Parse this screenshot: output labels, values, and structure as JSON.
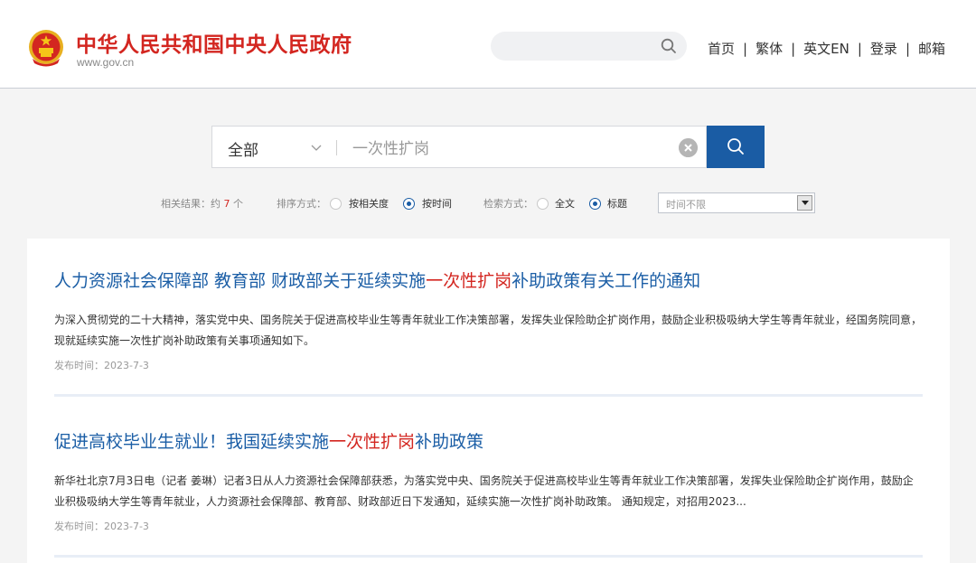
{
  "header": {
    "site_title": "中华人民共和国中央人民政府",
    "site_url": "www.gov.cn",
    "nav": [
      {
        "label": "首页"
      },
      {
        "label": "繁体"
      },
      {
        "label": "英文EN"
      },
      {
        "label": "登录"
      },
      {
        "label": "邮箱"
      }
    ],
    "separator": "|",
    "search_placeholder": ""
  },
  "search": {
    "scope": "全部",
    "query": "一次性扩岗"
  },
  "filters": {
    "result_count_prefix": "相关结果：约",
    "result_count": "7",
    "result_count_suffix": "个",
    "sort_label": "排序方式：",
    "sort_options": [
      "按相关度",
      "按时间"
    ],
    "sort_selected": "按时间",
    "mode_label": "检索方式：",
    "mode_options": [
      "全文",
      "标题"
    ],
    "mode_selected": "标题",
    "time_select": "时间不限"
  },
  "results": [
    {
      "title_before": "人力资源社会保障部 教育部 财政部关于延续实施",
      "title_highlight": "一次性扩岗",
      "title_after": "补助政策有关工作的通知",
      "abstract": "为深入贯彻党的二十大精神，落实党中央、国务院关于促进高校毕业生等青年就业工作决策部署，发挥失业保险助企扩岗作用，鼓励企业积极吸纳大学生等青年就业，经国务院同意，现就延续实施一次性扩岗补助政策有关事项通知如下。",
      "date": "发布时间：2023-7-3"
    },
    {
      "title_before": "促进高校毕业生就业！我国延续实施",
      "title_highlight": "一次性扩岗",
      "title_after": "补助政策",
      "abstract": "新华社北京7月3日电（记者 姜琳）记者3日从人力资源社会保障部获悉，为落实党中央、国务院关于促进高校毕业生等青年就业工作决策部署，发挥失业保险助企扩岗作用，鼓励企业积极吸纳大学生等青年就业，人力资源社会保障部、教育部、财政部近日下发通知，延续实施一次性扩岗补助政策。 通知规定，对招用2023...",
      "date": "发布时间：2023-7-3"
    }
  ],
  "colors": {
    "brand_red": "#d32620",
    "link_blue": "#1b5ea6",
    "button_blue": "#1a5ca4"
  }
}
